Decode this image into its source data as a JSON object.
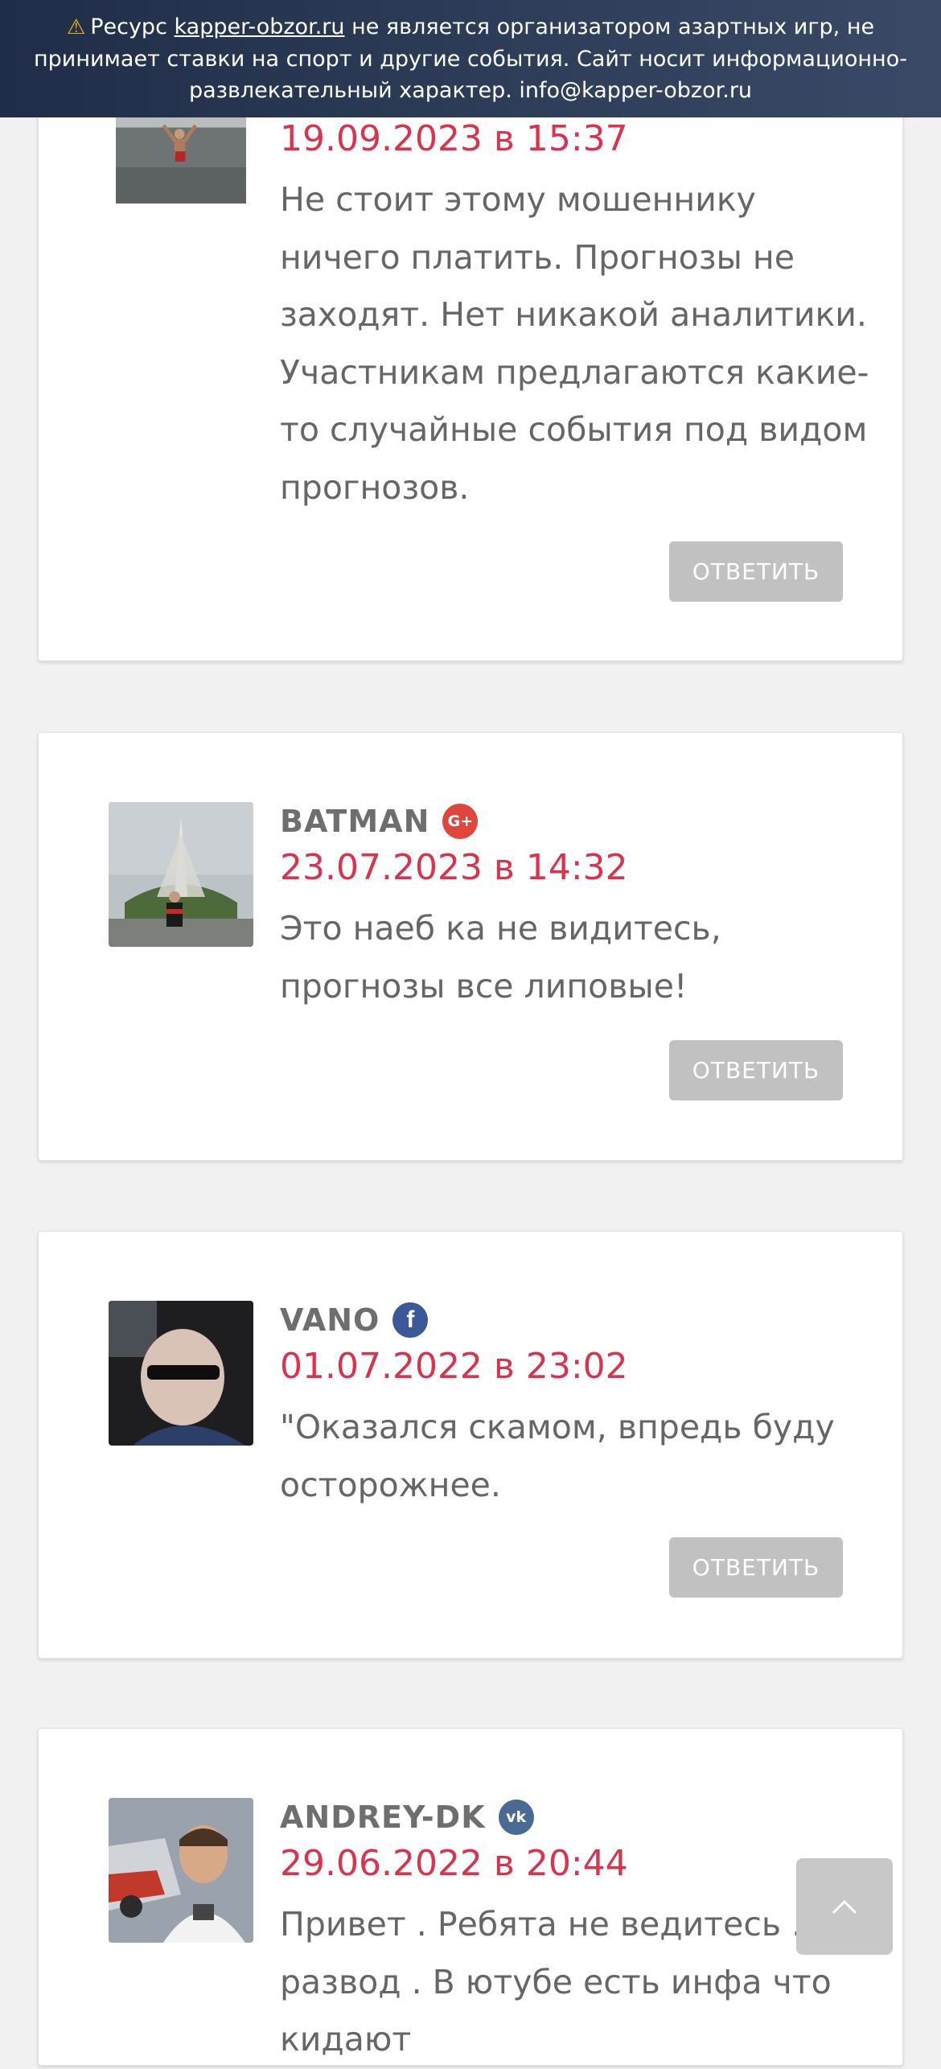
{
  "banner": {
    "prefix": "Ресурс ",
    "link": "kapper-obzor.ru",
    "suffix": " не является организатором азартных игр, не принимает ставки на спорт и другие события. Сайт носит информационно-развлекательный характер. info@kapper-obzor.ru"
  },
  "reply_label": "ОТВЕТИТЬ",
  "comments": [
    {
      "date": "19.09.2023 в 15:37",
      "text": "Не стоит этому мошеннику ничего платить. Прогнозы не заходят. Нет никакой аналитики. Участникам предлагаются какие-то случайные события под видом прогнозов."
    },
    {
      "author": "BATMAN",
      "social": "G+",
      "social_icon": "google-plus-icon",
      "date": "23.07.2023 в 14:32",
      "text": "Это наеб ка не видитесь, прогнозы все липовые!"
    },
    {
      "author": "VANO",
      "social": "f",
      "social_icon": "facebook-icon",
      "date": "01.07.2022 в 23:02",
      "text": "\"Оказался скамом, впредь буду осторожнее."
    },
    {
      "author": "ANDREY-DK",
      "social": "vk",
      "social_icon": "vk-icon",
      "date": "29.06.2022 в 20:44",
      "text": "Привет . Ребята не ведитесь . Это развод . В ютубе есть инфа что кидают"
    }
  ],
  "colors": {
    "date": "#d9334e",
    "reply_button": "#c1c1c1",
    "banner_bg": "#2b3a55",
    "page_bg": "#f1f1f1"
  }
}
